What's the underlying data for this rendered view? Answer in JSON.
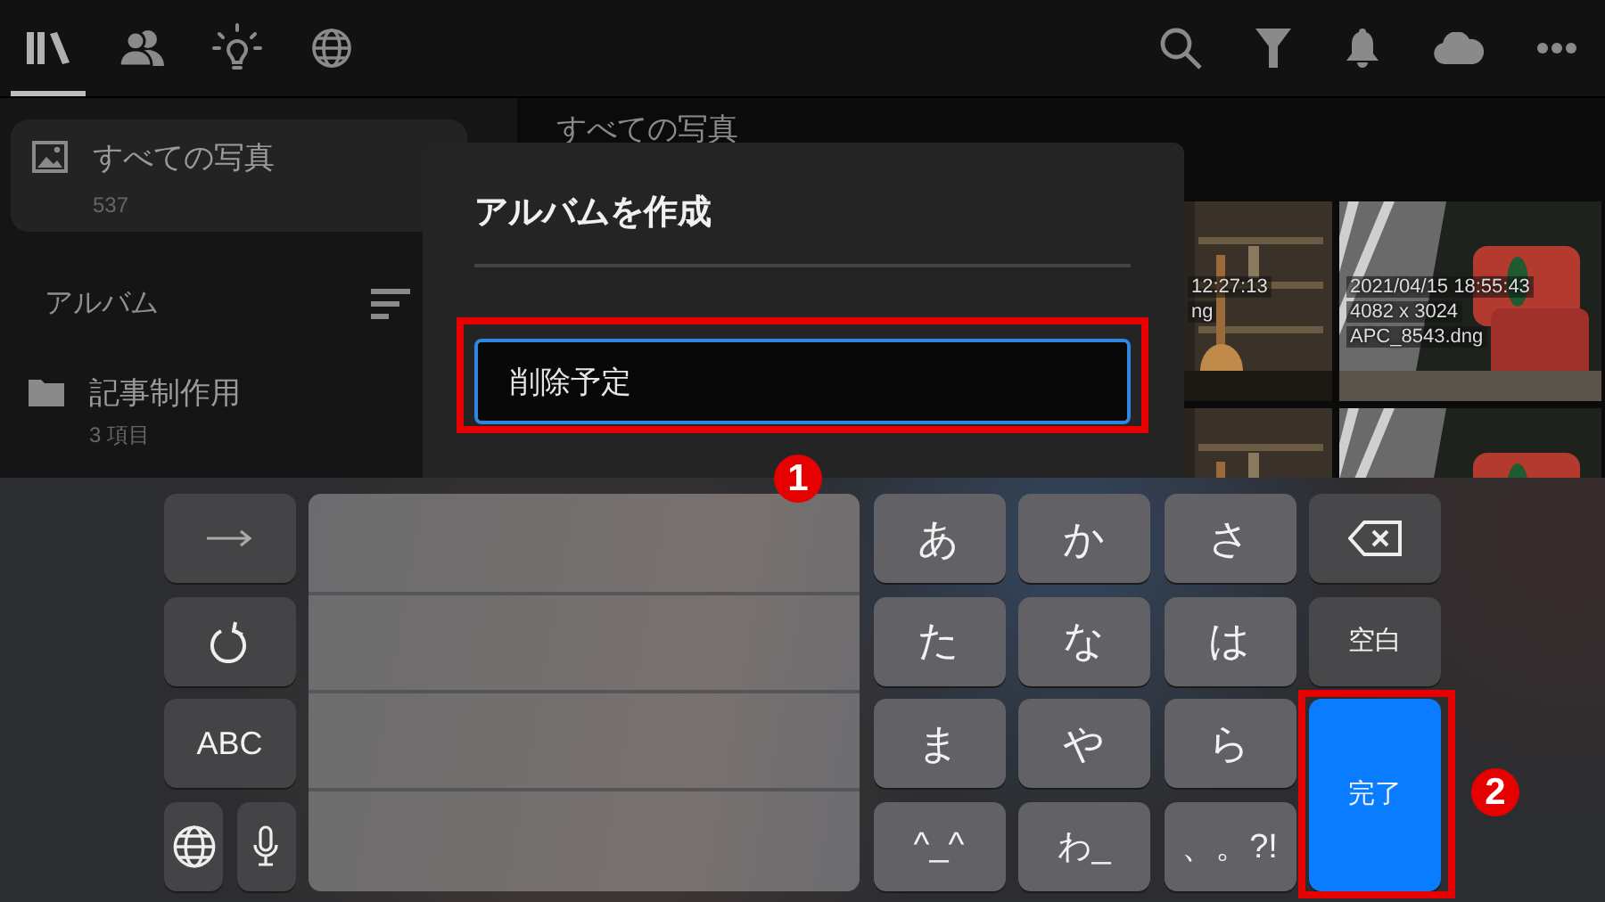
{
  "toolbar": {
    "tabs": [
      {
        "kind": "library",
        "selected": true
      },
      {
        "kind": "people",
        "selected": false
      },
      {
        "kind": "ideas",
        "selected": false
      },
      {
        "kind": "globe",
        "selected": false
      }
    ]
  },
  "sidebar": {
    "items": [
      {
        "label": "すべての写真",
        "count": "537",
        "selected": true
      }
    ],
    "section_title": "アルバム",
    "albums": [
      {
        "label": "記事制作用",
        "count": "3 項目"
      }
    ]
  },
  "main": {
    "title": "すべての写真",
    "photos": [
      {
        "kind": "picture",
        "caption": [
          "12:27:13",
          "ng"
        ]
      },
      {
        "kind": "picture",
        "caption": [
          "2021/04/15 18:55:43",
          "4082 x 3024",
          "APC_8543.dng"
        ]
      },
      {
        "kind": "picture"
      },
      {
        "kind": "picture"
      }
    ]
  },
  "dialog": {
    "title": "アルバムを作成",
    "field_value": "削除予定"
  },
  "keyboard": {
    "side_keys": [
      {
        "kind": "next"
      },
      {
        "kind": "undo"
      },
      {
        "kind": "text",
        "label": "ABC"
      },
      {
        "kind": "globe"
      },
      {
        "kind": "mic"
      }
    ],
    "kana_keys": [
      "あ",
      "か",
      "さ",
      "た",
      "な",
      "は",
      "ま",
      "や",
      "ら",
      "^_^",
      "わ_",
      "、。?!"
    ],
    "right_keys": [
      {
        "kind": "delete"
      },
      {
        "kind": "text",
        "label": "空白"
      },
      {
        "kind": "action",
        "label": "完了"
      }
    ]
  },
  "annotations": [
    {
      "label": "1"
    },
    {
      "label": "2"
    }
  ]
}
